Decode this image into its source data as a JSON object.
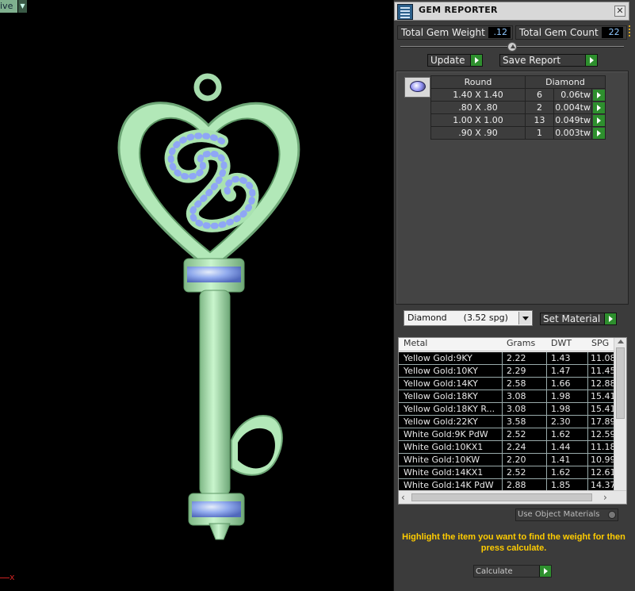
{
  "viewport": {
    "view_mode": "ive",
    "axis_label": "x",
    "colors": {
      "metal": "#b7ebbd",
      "stone": "#8fa6f5",
      "background": "#000000"
    }
  },
  "panel": {
    "title": "GEM REPORTER",
    "close_glyph": "✕",
    "total_gem_weight_label": "Total Gem Weight",
    "total_gem_weight_value": ".12",
    "total_gem_count_label": "Total Gem Count",
    "total_gem_count_value": "22",
    "update_label": "Update",
    "save_report_label": "Save Report"
  },
  "gem_table": {
    "header_shape": "Round",
    "header_material": "Diamond",
    "rows": [
      {
        "size": "1.40 X 1.40",
        "count": "6",
        "weight": "0.06tw"
      },
      {
        "size": ".80 X .80",
        "count": "2",
        "weight": "0.004tw"
      },
      {
        "size": "1.00 X 1.00",
        "count": "13",
        "weight": "0.049tw"
      },
      {
        "size": ".90 X .90",
        "count": "1",
        "weight": "0.003tw"
      }
    ]
  },
  "material": {
    "selected": "Diamond      (3.52 spg)",
    "set_label": "Set Material"
  },
  "metal_table": {
    "headers": [
      "Metal",
      "Grams",
      "DWT",
      "SPG"
    ],
    "rows": [
      {
        "metal": "Yellow Gold:9KY",
        "grams": "2.22",
        "dwt": "1.43",
        "spg": "11.08"
      },
      {
        "metal": "Yellow Gold:10KY",
        "grams": "2.29",
        "dwt": "1.47",
        "spg": "11.45"
      },
      {
        "metal": "Yellow Gold:14KY",
        "grams": "2.58",
        "dwt": "1.66",
        "spg": "12.88"
      },
      {
        "metal": "Yellow Gold:18KY",
        "grams": "3.08",
        "dwt": "1.98",
        "spg": "15.41"
      },
      {
        "metal": "Yellow Gold:18KY R...",
        "grams": "3.08",
        "dwt": "1.98",
        "spg": "15.41"
      },
      {
        "metal": "Yellow Gold:22KY",
        "grams": "3.58",
        "dwt": "2.30",
        "spg": "17.89"
      },
      {
        "metal": "White Gold:9K PdW",
        "grams": "2.52",
        "dwt": "1.62",
        "spg": "12.59"
      },
      {
        "metal": "White Gold:10KX1",
        "grams": "2.24",
        "dwt": "1.44",
        "spg": "11.18"
      },
      {
        "metal": "White Gold:10KW",
        "grams": "2.20",
        "dwt": "1.41",
        "spg": "10.99"
      },
      {
        "metal": "White Gold:14KX1",
        "grams": "2.52",
        "dwt": "1.62",
        "spg": "12.61"
      },
      {
        "metal": "White Gold:14K PdW",
        "grams": "2.88",
        "dwt": "1.85",
        "spg": "14.37"
      }
    ]
  },
  "use_object_materials_label": "Use Object Materials",
  "hint": "Highlight the item you want to find the weight for then press calculate.",
  "calculate_label": "Calculate"
}
